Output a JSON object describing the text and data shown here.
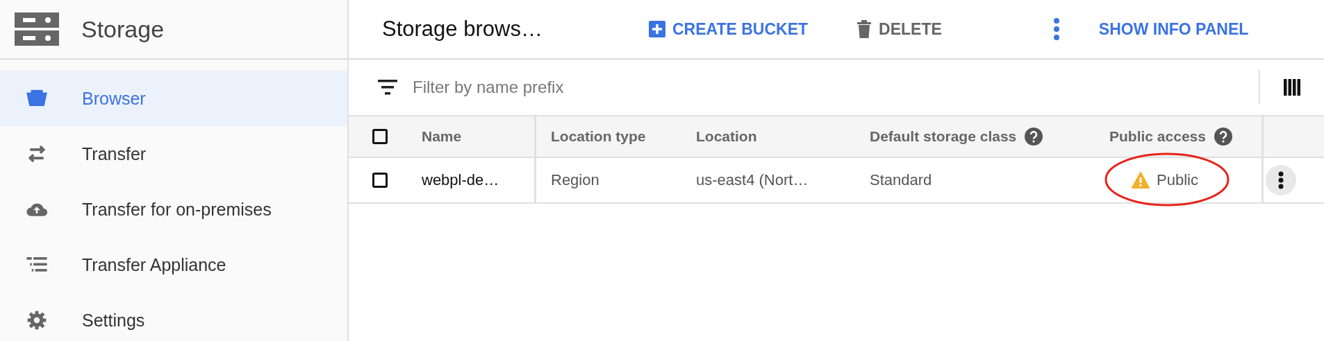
{
  "sidebar": {
    "title": "Storage",
    "items": [
      {
        "label": "Browser",
        "kind": "bucket",
        "selected": true
      },
      {
        "label": "Transfer",
        "kind": "arrows",
        "selected": false
      },
      {
        "label": "Transfer for on-premises",
        "kind": "cloud",
        "selected": false
      },
      {
        "label": "Transfer Appliance",
        "kind": "list",
        "selected": false
      },
      {
        "label": "Settings",
        "kind": "gear",
        "selected": false
      }
    ]
  },
  "toolbar": {
    "title": "Storage brows…",
    "create_button": "CREATE BUCKET",
    "delete_button": "DELETE",
    "info_button": "SHOW INFO PANEL"
  },
  "filter": {
    "placeholder": "Filter by name prefix"
  },
  "table": {
    "select_all_checked": false,
    "columns": [
      {
        "label": "Name",
        "help": false
      },
      {
        "label": "Location type",
        "help": false
      },
      {
        "label": "Location",
        "help": false
      },
      {
        "label": "Default storage class",
        "help": true
      },
      {
        "label": "Public access",
        "help": true
      }
    ],
    "rows": [
      {
        "checked": false,
        "name": "webpl-de…",
        "location_type": "Region",
        "location": "us-east4 (Nort…",
        "storage_class": "Standard",
        "public_access": "Public",
        "warning": true
      }
    ]
  }
}
